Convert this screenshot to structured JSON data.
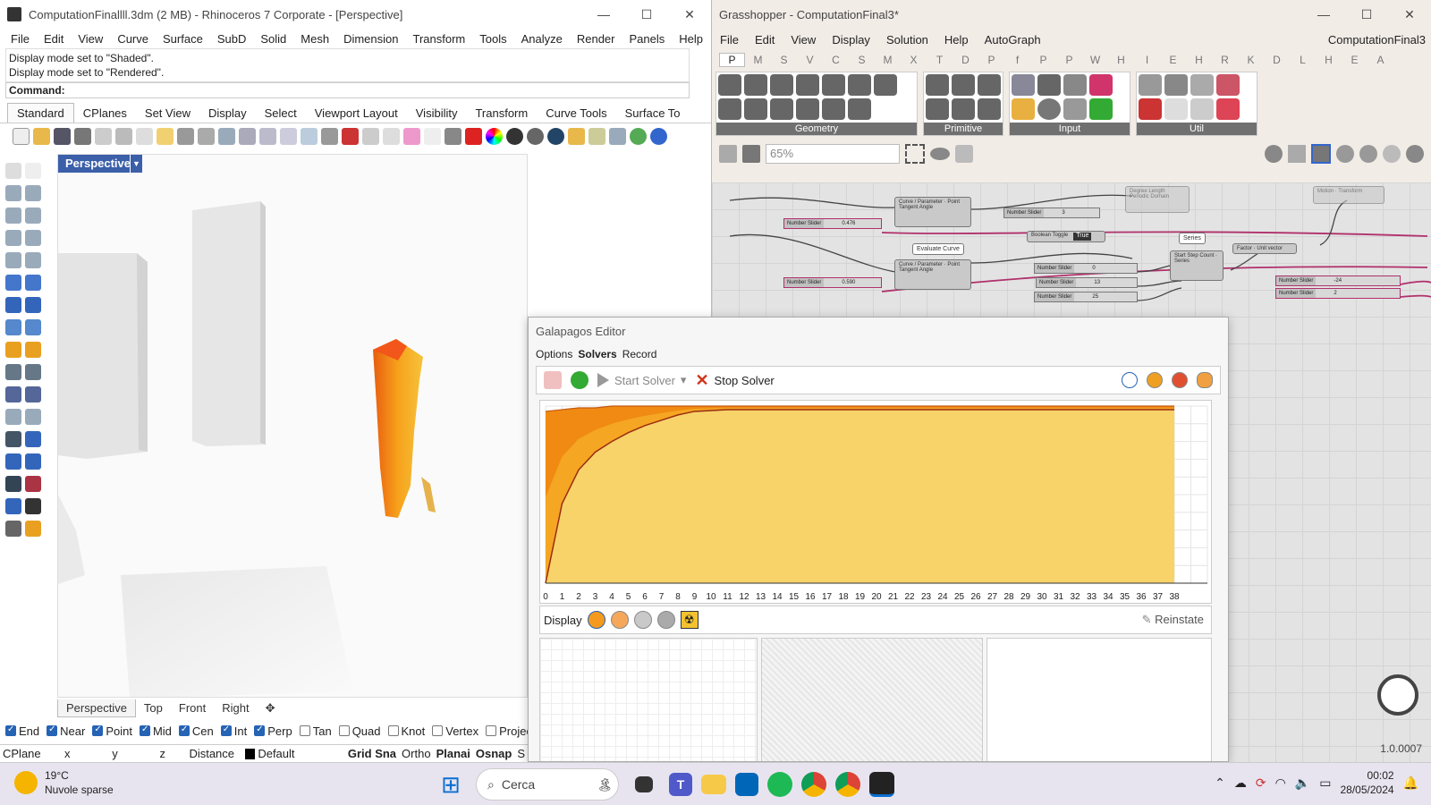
{
  "rhino": {
    "title": "ComputationFinallll.3dm (2 MB) - Rhinoceros 7 Corporate - [Perspective]",
    "menu": [
      "File",
      "Edit",
      "View",
      "Curve",
      "Surface",
      "SubD",
      "Solid",
      "Mesh",
      "Dimension",
      "Transform",
      "Tools",
      "Analyze",
      "Render",
      "Panels",
      "Help"
    ],
    "history": [
      "Display mode set to \"Shaded\".",
      "Display mode set to \"Rendered\"."
    ],
    "command_label": "Command:",
    "toolbar_tabs": [
      "Standard",
      "CPlanes",
      "Set View",
      "Display",
      "Select",
      "Viewport Layout",
      "Visibility",
      "Transform",
      "Curve Tools",
      "Surface To"
    ],
    "viewport_title": "Perspective",
    "view_tabs": [
      "Perspective",
      "Top",
      "Front",
      "Right"
    ],
    "osnaps": [
      {
        "label": "End",
        "checked": true
      },
      {
        "label": "Near",
        "checked": true
      },
      {
        "label": "Point",
        "checked": true
      },
      {
        "label": "Mid",
        "checked": true
      },
      {
        "label": "Cen",
        "checked": true
      },
      {
        "label": "Int",
        "checked": true
      },
      {
        "label": "Perp",
        "checked": true
      },
      {
        "label": "Tan",
        "checked": false
      },
      {
        "label": "Quad",
        "checked": false
      },
      {
        "label": "Knot",
        "checked": false
      },
      {
        "label": "Vertex",
        "checked": false
      },
      {
        "label": "Project",
        "checked": false
      }
    ],
    "status": {
      "cplane": "CPlane",
      "x": "x",
      "y": "y",
      "z": "z",
      "distance": "Distance",
      "layer": "Default",
      "grid": "Grid Sna",
      "ortho": "Ortho",
      "planar": "Planai",
      "osnap": "Osnap",
      "s": "S"
    }
  },
  "grasshopper": {
    "title": "Grasshopper - ComputationFinal3*",
    "menu": [
      "File",
      "Edit",
      "View",
      "Display",
      "Solution",
      "Help",
      "AutoGraph"
    ],
    "doc_name": "ComputationFinal3",
    "tabs": [
      "P",
      "M",
      "S",
      "V",
      "C",
      "S",
      "M",
      "X",
      "T",
      "D",
      "P",
      "f",
      "P",
      "P",
      "W",
      "H",
      "I",
      "E",
      "H",
      "R",
      "K",
      "D",
      "L",
      "H",
      "E",
      "A"
    ],
    "ribbon_groups": [
      "Geometry",
      "Primitive",
      "Input",
      "Util"
    ],
    "zoom": "65%",
    "version": "1.0.0007",
    "nodes": {
      "slider": "Number Slider",
      "slider_vals": [
        "0.476",
        "0.590",
        "3",
        "0",
        "13",
        "25",
        "-24",
        "2"
      ],
      "boolean": "Boolean Toggle",
      "boolean_val": "True",
      "evaluate": "Evaluate Curve",
      "series": "Series"
    }
  },
  "galapagos": {
    "title": "Galapagos Editor",
    "tabs": [
      "Options",
      "Solvers",
      "Record"
    ],
    "active_tab": "Solvers",
    "start": "Start Solver",
    "stop": "Stop Solver",
    "display_label": "Display",
    "reinstate": "Reinstate",
    "chart_data": {
      "type": "area",
      "x": [
        0,
        1,
        2,
        3,
        4,
        5,
        6,
        7,
        8,
        9,
        10,
        11,
        12,
        13,
        14,
        15,
        16,
        17,
        18,
        19,
        20,
        21,
        22,
        23,
        24,
        25,
        26,
        27,
        28,
        29,
        30,
        31,
        32,
        33,
        34,
        35,
        36,
        37,
        38
      ],
      "xlim": [
        0,
        40
      ],
      "series": [
        {
          "values": [
            0,
            45,
            64,
            74,
            80,
            85,
            89,
            92,
            95,
            97,
            97.5,
            98,
            98,
            98,
            98,
            98,
            98,
            98,
            98,
            98,
            98,
            98,
            98,
            98,
            98,
            98,
            98,
            98,
            98,
            98,
            98,
            98,
            98,
            98,
            98,
            98,
            98,
            98,
            98
          ]
        },
        {
          "values": [
            97,
            98,
            99,
            99,
            100,
            100,
            100,
            100,
            100,
            100,
            100,
            100,
            100,
            100,
            100,
            100,
            100,
            100,
            100,
            100,
            100,
            100,
            100,
            100,
            100,
            100,
            100,
            100,
            100,
            100,
            100,
            100,
            100,
            100,
            100,
            100,
            100,
            100,
            100
          ]
        }
      ],
      "grid": true
    }
  },
  "taskbar": {
    "temp": "19°C",
    "weather": "Nuvole sparse",
    "search": "Cerca",
    "time": "00:02",
    "date": "28/05/2024"
  }
}
